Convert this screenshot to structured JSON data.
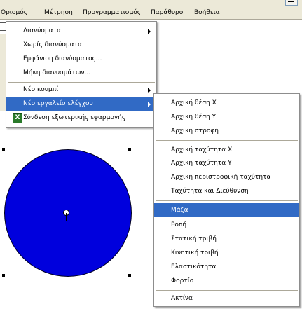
{
  "menubar": {
    "items": [
      "Ορισμός",
      "Μέτρηση",
      "Προγραμματισμός",
      "Παράθυρο",
      "Βοήθεια"
    ]
  },
  "main_menu": {
    "items": [
      {
        "label": "Διανύσματα",
        "submenu": true
      },
      {
        "label": "Χωρίς διανύσματα"
      },
      {
        "label": "Εμφάνιση διανύσματος..."
      },
      {
        "label": "Μήκη διανυσμάτων..."
      },
      {
        "label": "Νέο κουμπί",
        "submenu": true
      },
      {
        "label": "Νέο εργαλείο ελέγχου",
        "submenu": true,
        "selected": true
      },
      {
        "label": "Σύνδεση εξωτερικής εφαρμογής",
        "icon": "excel-icon"
      }
    ]
  },
  "sub_menu": {
    "items": [
      "Αρχική θέση X",
      "Αρχική θέση Y",
      "Αρχική στροφή",
      "Αρχική ταχύτητα X",
      "Αρχική ταχύτητα Y",
      "Αρχική περιστροφική ταχύτητα",
      "Ταχύτητα και Διεύθυνση",
      "Μάζα",
      "Ροπή",
      "Στατική τριβή",
      "Κινητική τριβή",
      "Ελαστικότητα",
      "Φορτίο",
      "Ακτίνα"
    ],
    "selected": "Μάζα"
  },
  "colors": {
    "highlight": "#316ac5",
    "circle_fill": "#0000dd",
    "menubar_bg": "#ece9d8"
  }
}
